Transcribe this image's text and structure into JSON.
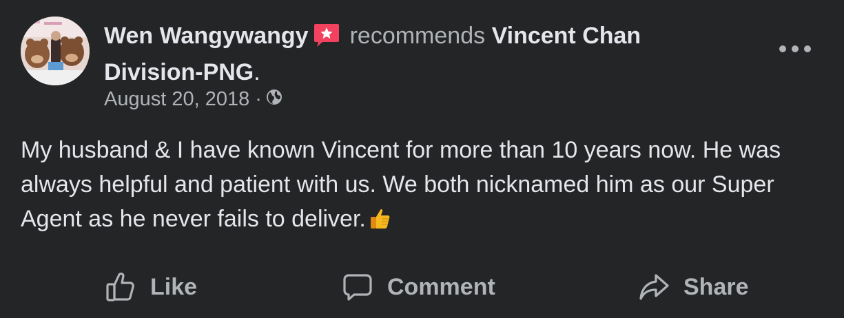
{
  "post": {
    "author": "Wen Wangywangy",
    "recommends_text": "recommends",
    "page_name": "Vincent Chan Division-PNG",
    "period": ".",
    "date": "August 20, 2018",
    "separator": "·",
    "audience_icon": "globe-icon",
    "recommend_icon": "recommend-star-icon",
    "body": "My husband & I have known Vincent for more than 10 years now. He was always helpful and patient with us. We both nicknamed him as our Super Agent as he never fails to deliver.",
    "body_emoji": "thumbs-up-emoji"
  },
  "actions": {
    "like_label": "Like",
    "comment_label": "Comment",
    "share_label": "Share"
  },
  "colors": {
    "background": "#242526",
    "primary_text": "#e4e6eb",
    "secondary_text": "#b0b3b8",
    "recommend_badge": "#f3425f"
  }
}
